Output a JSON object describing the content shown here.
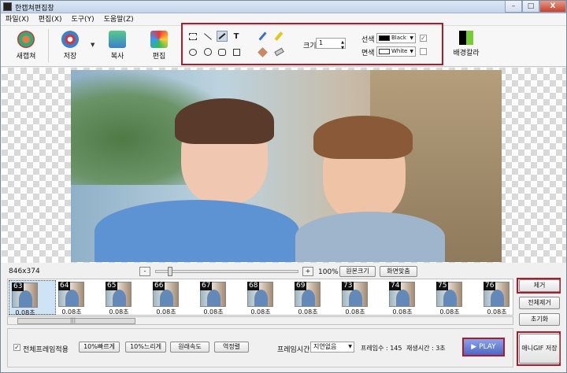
{
  "window": {
    "title": "한캡쳐편집창",
    "min": "–",
    "max": "□",
    "close": "X"
  },
  "menu": [
    "파일(X)",
    "편집(X)",
    "도구(Y)",
    "도움말(Z)"
  ],
  "toolbar": {
    "new_capture": "새캡쳐",
    "save": "저장",
    "copy": "복사",
    "edit": "편집",
    "size_label": "크기",
    "size_value": "1",
    "line_label": "선색",
    "line_color_name": "Black",
    "line_color": "#000000",
    "face_label": "면색",
    "face_color_name": "White",
    "face_color": "#ffffff",
    "background_color": "배경칼라",
    "text_tool": "T",
    "spin_up": "▲",
    "spin_down": "▼",
    "dropdown_arrow": "▼",
    "checkbox_mark": "✓"
  },
  "status": {
    "image_size": "846x374",
    "zoom_minus": "-",
    "zoom_plus": "+",
    "zoom_percent": "100%",
    "original_size": "원본크기",
    "fit_screen": "화면맞춤"
  },
  "frames": [
    {
      "num": "63",
      "dur": "0.08초",
      "selected": true
    },
    {
      "num": "64",
      "dur": "0.08초"
    },
    {
      "num": "65",
      "dur": "0.08초"
    },
    {
      "num": "66",
      "dur": "0.08초"
    },
    {
      "num": "67",
      "dur": "0.08초"
    },
    {
      "num": "68",
      "dur": "0.08초"
    },
    {
      "num": "69",
      "dur": "0.08초"
    },
    {
      "num": "73",
      "dur": "0.08초"
    },
    {
      "num": "74",
      "dur": "0.08초"
    },
    {
      "num": "75",
      "dur": "0.08초"
    },
    {
      "num": "76",
      "dur": "0.08초"
    }
  ],
  "scrollbar_grip": "|||",
  "side": {
    "remove": "제거",
    "remove_all": "전체제거",
    "reset": "초기화",
    "save_gif": "애니GIF 저장"
  },
  "bottom": {
    "apply_all": "전체프레임적용",
    "faster": "10%빠르게",
    "slower": "10%느리게",
    "original_speed": "원래속도",
    "reverse": "역정렬",
    "frame_time_label": "프레임시간",
    "frame_time_value": "지연없음",
    "frame_count": "프레임수 : 145",
    "play_time": "재생시간 : 3초",
    "play": "▶ PLAY"
  },
  "colors": {
    "accent_red": "#b11a2b",
    "play_blue": "#4d67c7",
    "selection": "#cfe3f7"
  }
}
